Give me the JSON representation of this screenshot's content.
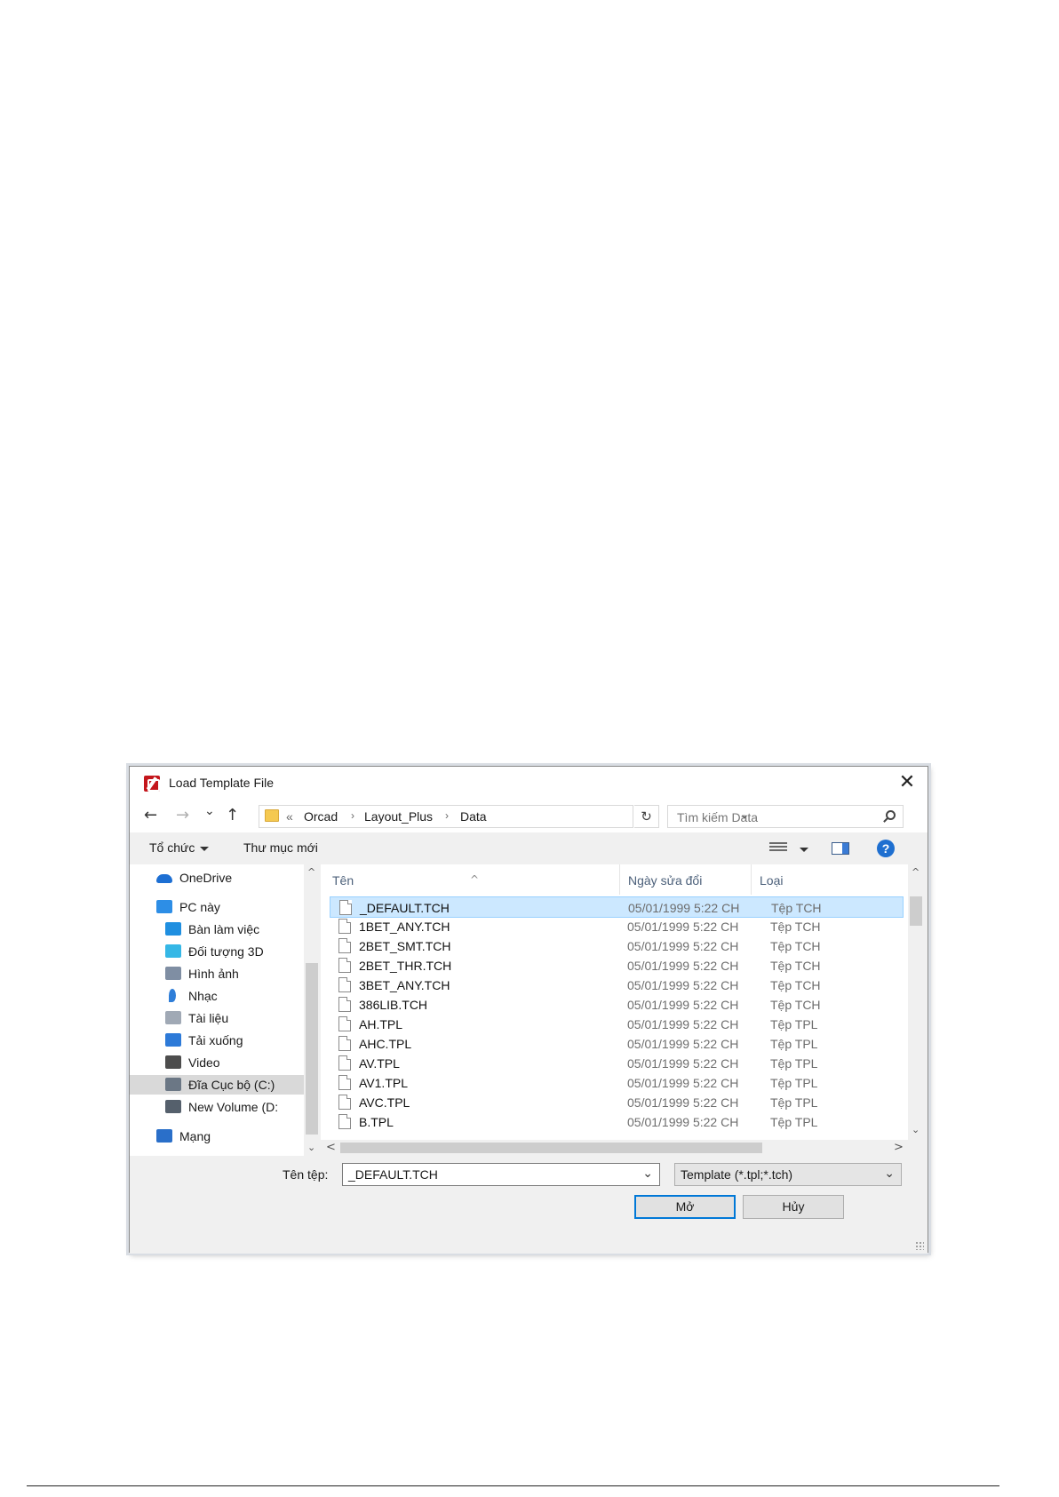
{
  "window": {
    "title": "Load Template File",
    "close_glyph": "✕"
  },
  "navigation": {
    "back_glyph": "←",
    "forward_glyph": "→",
    "recent_glyph": "⌄",
    "up_glyph": "↑",
    "breadcrumb_overflow": "«",
    "breadcrumb": [
      "Orcad",
      "Layout_Plus",
      "Data"
    ],
    "separator_glyph": "›",
    "address_dropdown_glyph": "⌄",
    "refresh_glyph": "↻",
    "search_placeholder": "Tìm kiếm Data"
  },
  "toolbar": {
    "organize_label": "Tổ chức",
    "new_folder_label": "Thư mục mới",
    "help_label": "?"
  },
  "sidebar": {
    "items": [
      {
        "label": "OneDrive",
        "icon": "onedrive-cloud-icon",
        "color": "#1d6fd3"
      },
      {
        "label": "PC này",
        "icon": "computer-icon",
        "color": "#2d8ee6"
      },
      {
        "label": "Bàn làm việc",
        "icon": "desktop-icon",
        "color": "#1f8fe0"
      },
      {
        "label": "Đối tượng 3D",
        "icon": "cube-3d-icon",
        "color": "#35b7e6"
      },
      {
        "label": "Hình ảnh",
        "icon": "pictures-icon",
        "color": "#7f8ea3"
      },
      {
        "label": "Nhạc",
        "icon": "music-note-icon",
        "color": "#2f7ed8"
      },
      {
        "label": "Tài liệu",
        "icon": "documents-icon",
        "color": "#a0a9b5"
      },
      {
        "label": "Tải xuống",
        "icon": "download-arrow-icon",
        "color": "#2d7ad8"
      },
      {
        "label": "Video",
        "icon": "video-icon",
        "color": "#4d4d4d"
      },
      {
        "label": "Đĩa Cục bộ (C:)",
        "icon": "local-disk-icon",
        "color": "#6b7785"
      },
      {
        "label": "New Volume (D:",
        "icon": "drive-icon",
        "color": "#55606c"
      },
      {
        "label": "Mạng",
        "icon": "network-icon",
        "color": "#2a6fc9"
      }
    ]
  },
  "file_list": {
    "columns": [
      "Tên",
      "Ngày sửa đổi",
      "Loại"
    ],
    "sort_glyph": "^",
    "rows": [
      {
        "name": "_DEFAULT.TCH",
        "date": "05/01/1999 5:22 CH",
        "type": "Tệp TCH"
      },
      {
        "name": "1BET_ANY.TCH",
        "date": "05/01/1999 5:22 CH",
        "type": "Tệp TCH"
      },
      {
        "name": "2BET_SMT.TCH",
        "date": "05/01/1999 5:22 CH",
        "type": "Tệp TCH"
      },
      {
        "name": "2BET_THR.TCH",
        "date": "05/01/1999 5:22 CH",
        "type": "Tệp TCH"
      },
      {
        "name": "3BET_ANY.TCH",
        "date": "05/01/1999 5:22 CH",
        "type": "Tệp TCH"
      },
      {
        "name": "386LIB.TCH",
        "date": "05/01/1999 5:22 CH",
        "type": "Tệp TCH"
      },
      {
        "name": "AH.TPL",
        "date": "05/01/1999 5:22 CH",
        "type": "Tệp TPL"
      },
      {
        "name": "AHC.TPL",
        "date": "05/01/1999 5:22 CH",
        "type": "Tệp TPL"
      },
      {
        "name": "AV.TPL",
        "date": "05/01/1999 5:22 CH",
        "type": "Tệp TPL"
      },
      {
        "name": "AV1.TPL",
        "date": "05/01/1999 5:22 CH",
        "type": "Tệp TPL"
      },
      {
        "name": "AVC.TPL",
        "date": "05/01/1999 5:22 CH",
        "type": "Tệp TPL"
      },
      {
        "name": "B.TPL",
        "date": "05/01/1999 5:22 CH",
        "type": "Tệp TPL"
      }
    ],
    "selected_index": 0,
    "selection_color": "#cce8ff"
  },
  "scroll": {
    "up_glyph": "^",
    "down_glyph": "⌄",
    "left_glyph": "<",
    "right_glyph": ">"
  },
  "footer": {
    "filename_label": "Tên tệp:",
    "filename_value": "_DEFAULT.TCH",
    "filetype_value": "Template (*.tpl;*.tch)",
    "dropdown_glyph": "⌄",
    "open_label": "Mở",
    "cancel_label": "Hủy",
    "accent_color": "#0078d7"
  }
}
